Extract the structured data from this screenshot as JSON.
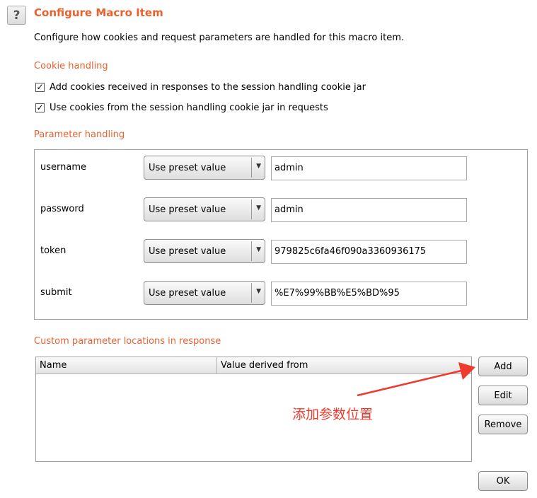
{
  "header": {
    "help_icon_glyph": "?",
    "title": "Configure Macro Item",
    "description": "Configure how cookies and request parameters are handled for this macro item."
  },
  "cookie_handling": {
    "heading": "Cookie handling",
    "options": [
      {
        "label": "Add cookies received in responses to the session handling cookie jar",
        "checked": true
      },
      {
        "label": "Use cookies from the session handling cookie jar in requests",
        "checked": true
      }
    ]
  },
  "parameter_handling": {
    "heading": "Parameter handling",
    "rows": [
      {
        "name": "username",
        "mode": "Use preset value",
        "value": "admin"
      },
      {
        "name": "password",
        "mode": "Use preset value",
        "value": "admin"
      },
      {
        "name": "token",
        "mode": "Use preset value",
        "value": "979825c6fa46f090a3360936175"
      },
      {
        "name": "submit",
        "mode": "Use preset value",
        "value": "%E7%99%BB%E5%BD%95"
      }
    ]
  },
  "custom_locations": {
    "heading": "Custom parameter locations in response",
    "columns": [
      "Name",
      "Value derived from"
    ],
    "rows": [],
    "buttons": {
      "add": "Add",
      "edit": "Edit",
      "remove": "Remove"
    }
  },
  "annotation": {
    "text": "添加参数位置",
    "color": "#ee3b2e"
  },
  "footer": {
    "ok": "OK"
  },
  "colors": {
    "accent": "#e8622e"
  }
}
